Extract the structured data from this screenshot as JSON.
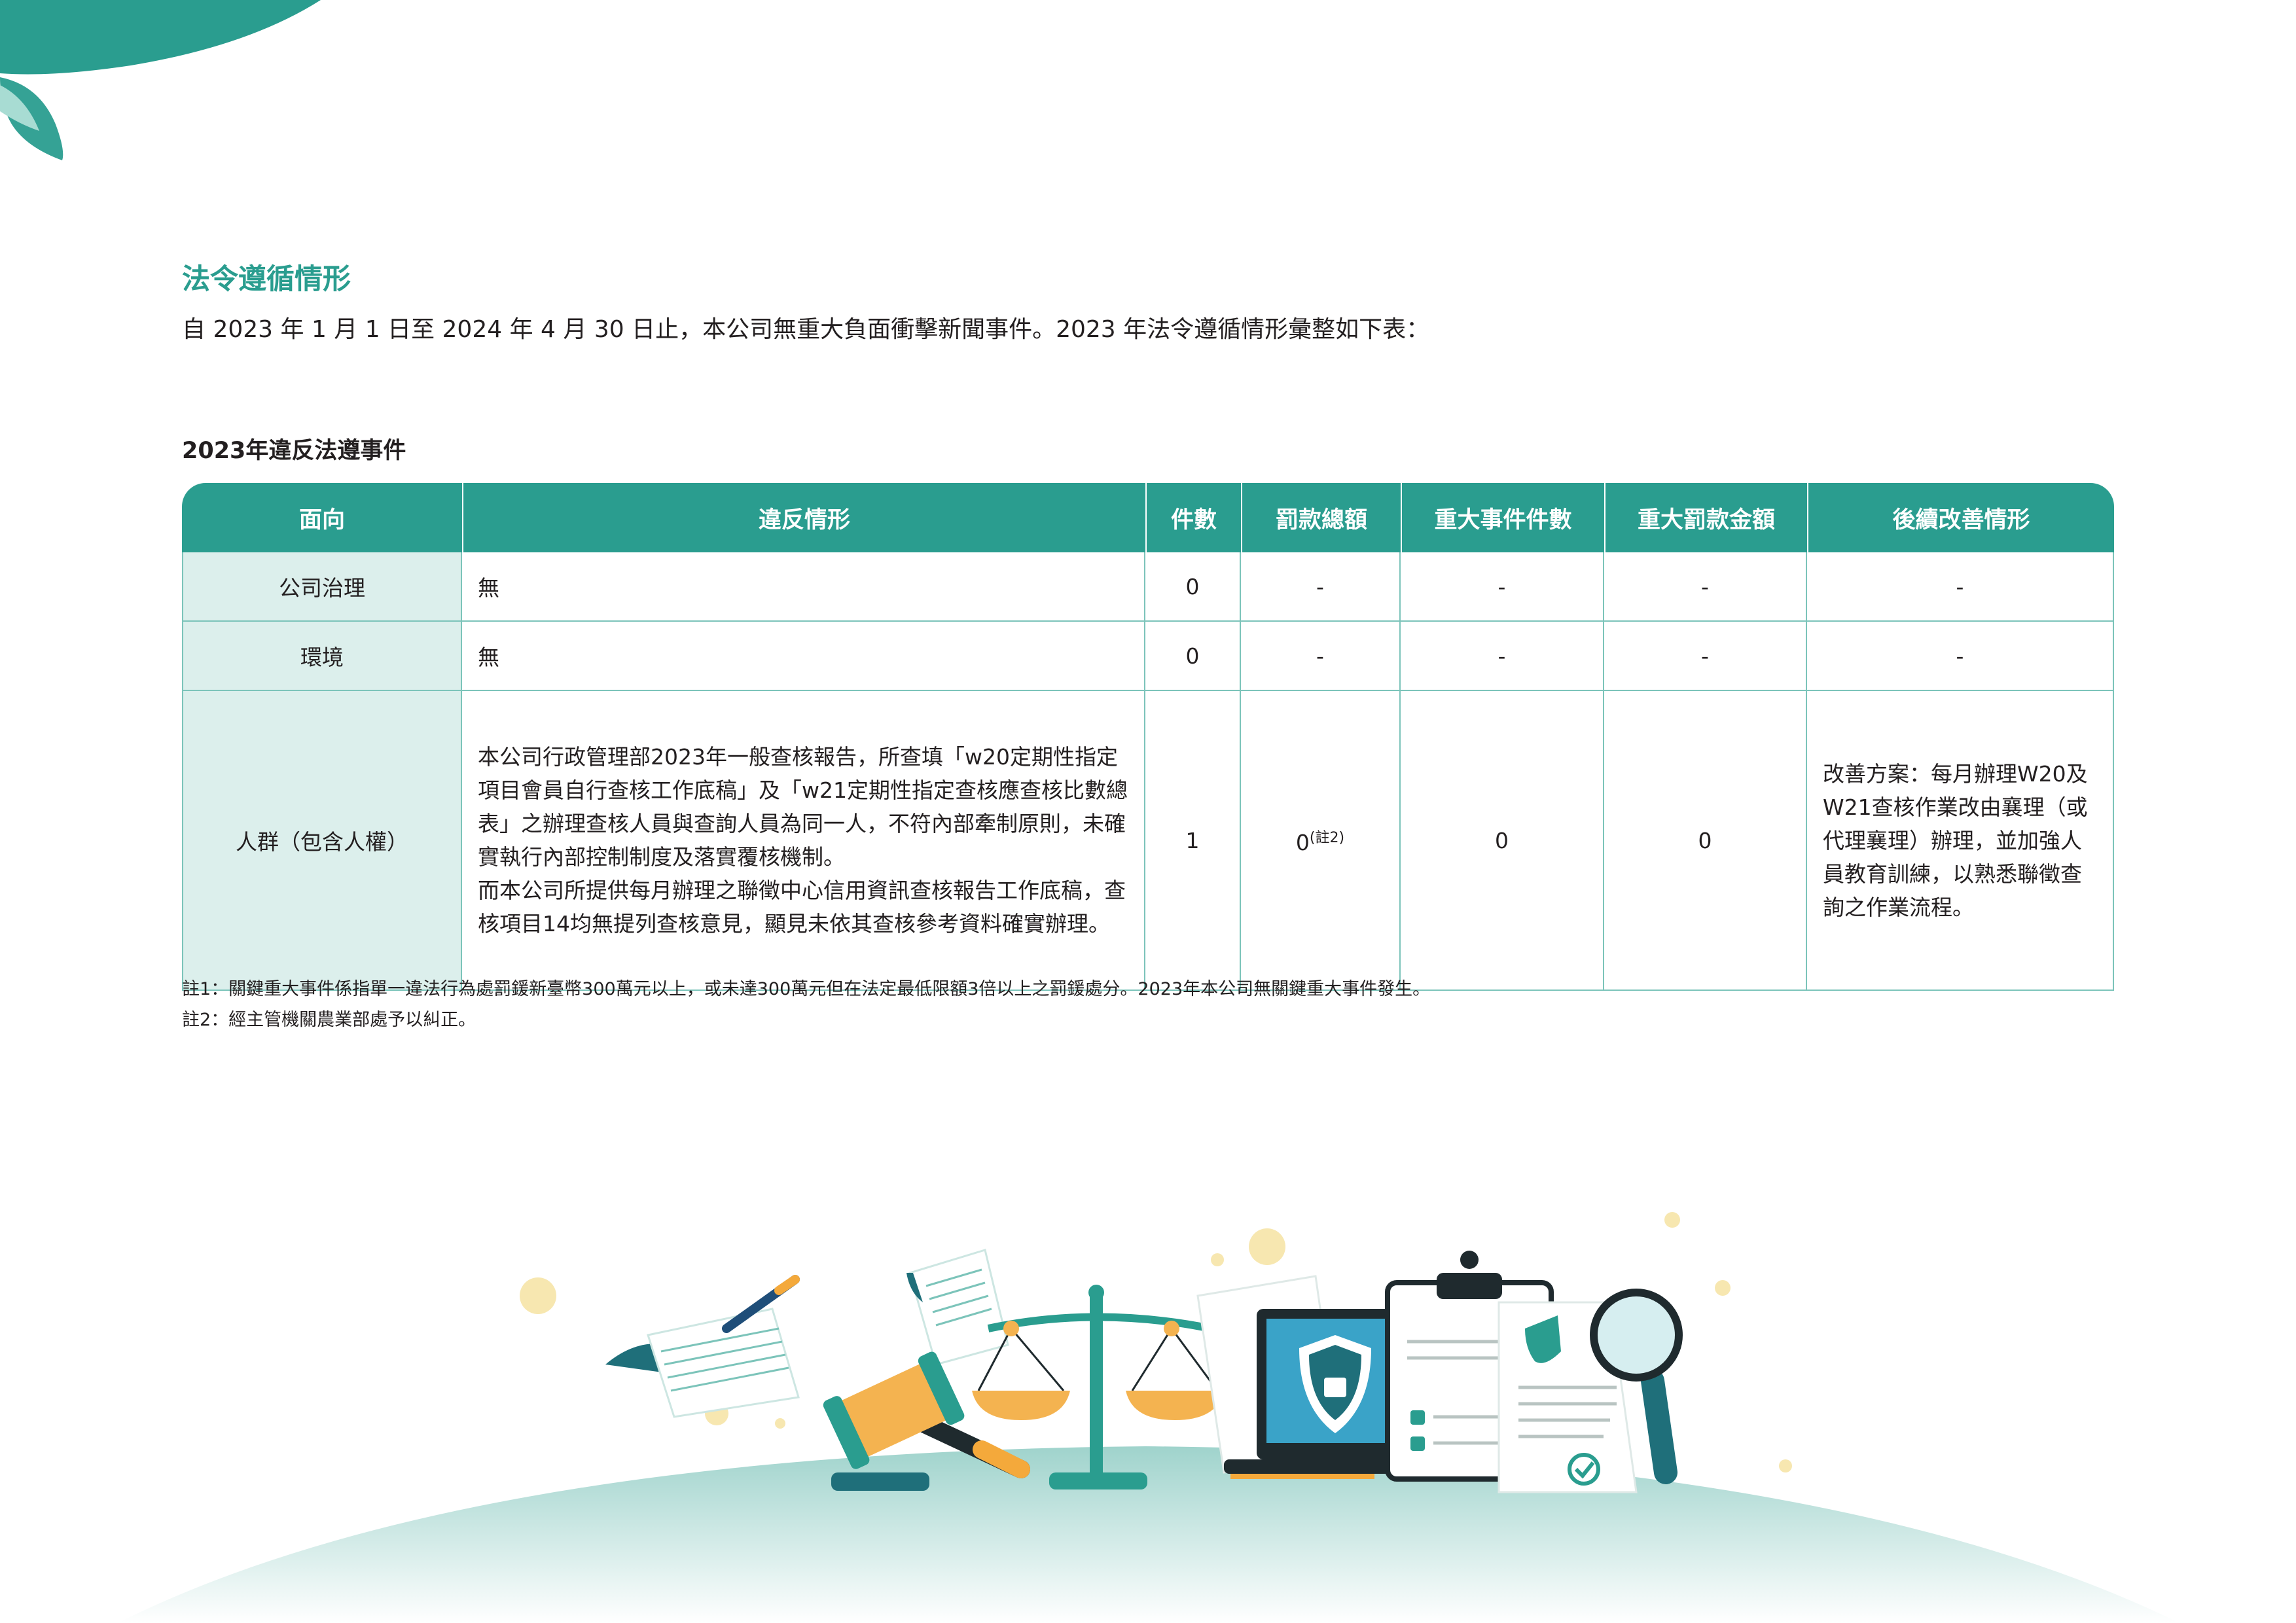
{
  "section": {
    "title": "法令遵循情形",
    "intro": "自 2023 年 1 月 1 日至 2024 年 4 月 30 日止，本公司無重大負面衝擊新聞事件。2023 年法令遵循情形彙整如下表："
  },
  "table": {
    "caption": "2023年違反法遵事件",
    "headers": [
      "面向",
      "違反情形",
      "件數",
      "罰款總額",
      "重大事件件數",
      "重大罰款金額",
      "後續改善情形"
    ],
    "rows": [
      {
        "aspect": "公司治理",
        "violation": "無",
        "count": "0",
        "fine": "-",
        "major_count": "-",
        "major_fine": "-",
        "improvement": "-"
      },
      {
        "aspect": "環境",
        "violation": "無",
        "count": "0",
        "fine": "-",
        "major_count": "-",
        "major_fine": "-",
        "improvement": "-"
      },
      {
        "aspect": "人群（包含人權）",
        "violation_p1": "本公司行政管理部2023年一般查核報告，所查填「w20定期性指定項目會員自行查核工作底稿」及「w21定期性指定查核應查核比數總表」之辦理查核人員與查詢人員為同一人，不符內部牽制原則，未確實執行內部控制制度及落實覆核機制。",
        "violation_p2": "而本公司所提供每月辦理之聯徵中心信用資訊查核報告工作底稿，查核項目14均無提列查核意見，顯見未依其查核參考資料確實辦理。",
        "count": "1",
        "fine": "0",
        "fine_note": "(註2)",
        "major_count": "0",
        "major_fine": "0",
        "improvement": "改善方案：每月辦理W20及W21查核作業改由襄理（或代理襄理）辦理，並加強人員教育訓練，以熟悉聯徵查詢之作業流程。"
      }
    ]
  },
  "notes": [
    "註1：關鍵重大事件係指單一違法行為處罰鍰新臺幣300萬元以上，或未達300萬元但在法定最低限額3倍以上之罰鍰處分。2023年本公司無關鍵重大事件發生。",
    "註2：經主管機關農業部處予以糾正。"
  ],
  "colors": {
    "accent": "#2a9d8f",
    "row_header_bg": "#dcefec",
    "border": "#7cc4ba"
  },
  "icons": [
    "gavel-icon",
    "scales-icon",
    "laptop-shield-icon",
    "clipboard-icon",
    "certificate-icon",
    "magnifier-icon",
    "document-pen-icon"
  ]
}
